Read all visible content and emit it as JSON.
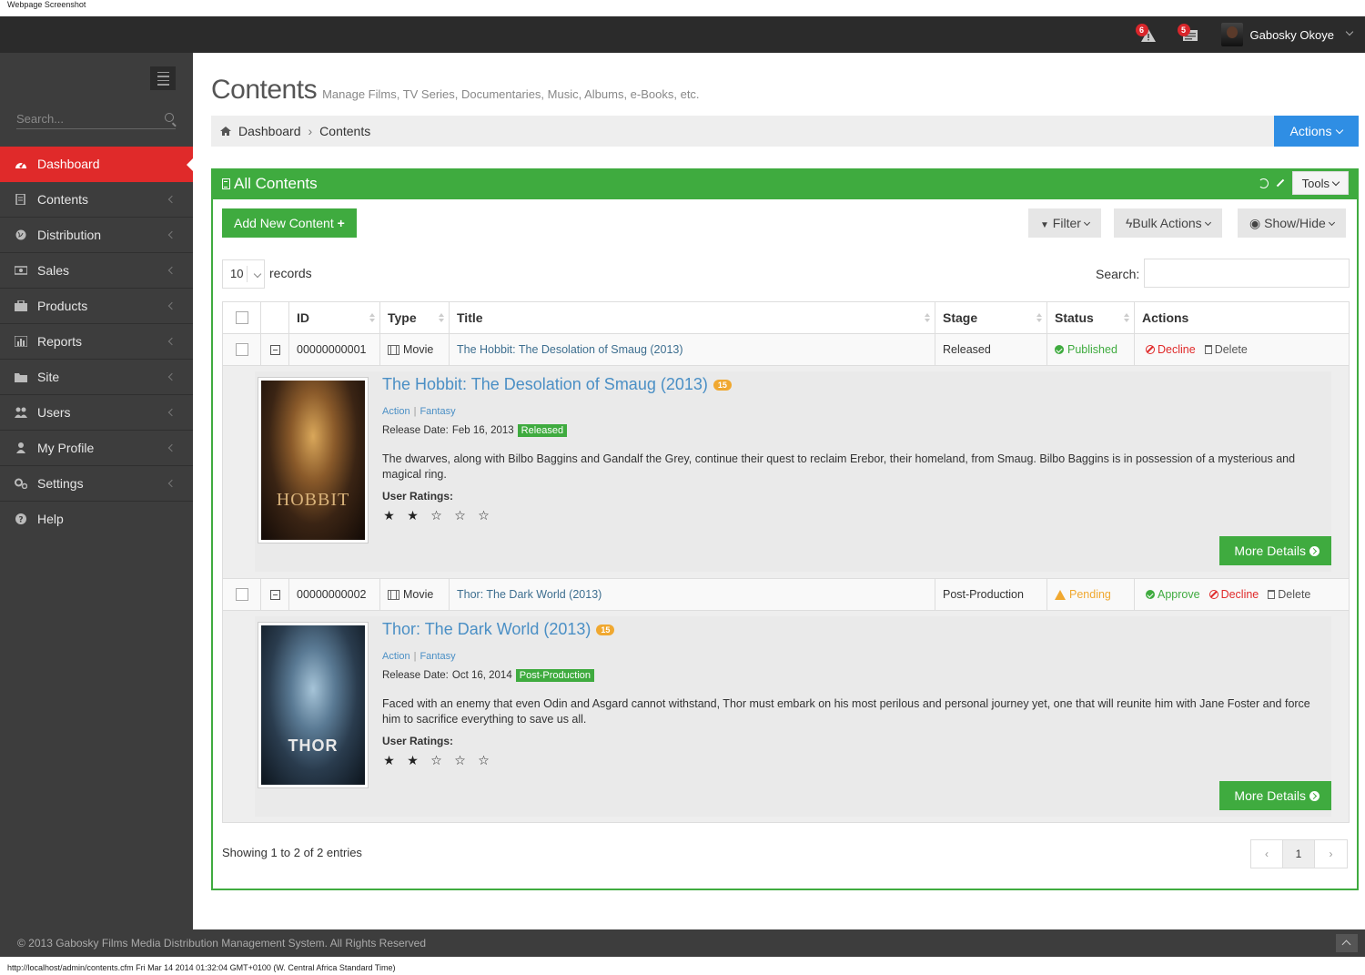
{
  "capture_label": "Webpage Screenshot",
  "topbar": {
    "notifications": [
      {
        "icon": "warning-icon",
        "count": "6"
      },
      {
        "icon": "messages-icon",
        "count": "5"
      }
    ],
    "user_name": "Gabosky Okoye"
  },
  "sidebar": {
    "search_placeholder": "Search...",
    "items": [
      {
        "label": "Dashboard",
        "icon": "dashboard-icon",
        "active": true
      },
      {
        "label": "Contents",
        "icon": "contents-icon"
      },
      {
        "label": "Distribution",
        "icon": "globe-icon"
      },
      {
        "label": "Sales",
        "icon": "money-icon"
      },
      {
        "label": "Products",
        "icon": "briefcase-icon"
      },
      {
        "label": "Reports",
        "icon": "bar-chart-icon"
      },
      {
        "label": "Site",
        "icon": "folder-icon"
      },
      {
        "label": "Users",
        "icon": "users-icon"
      },
      {
        "label": "My Profile",
        "icon": "user-icon"
      },
      {
        "label": "Settings",
        "icon": "cogs-icon"
      },
      {
        "label": "Help",
        "icon": "question-icon"
      }
    ]
  },
  "page": {
    "title": "Contents",
    "subtitle": "Manage Films, TV Series, Documentaries, Music, Albums, e-Books, etc.",
    "breadcrumb": [
      "Dashboard",
      "Contents"
    ],
    "actions_label": "Actions"
  },
  "panel": {
    "title": "All Contents",
    "tools_label": "Tools",
    "add_label": "Add New Content",
    "filter_label": "Filter",
    "bulk_label": "Bulk Actions",
    "showhide_label": "Show/Hide",
    "length_value": "10",
    "length_label": "records",
    "search_label": "Search:",
    "columns": [
      "ID",
      "Type",
      "Title",
      "Stage",
      "Status",
      "Actions"
    ],
    "rows": [
      {
        "id": "00000000001",
        "type": "Movie",
        "title": "The Hobbit: The Desolation of Smaug (2013)",
        "stage": "Released",
        "status": "Published",
        "actions": [
          "Decline",
          "Delete"
        ],
        "detail": {
          "title": "The Hobbit: The Desolation of Smaug (2013)",
          "age": "15",
          "genres": [
            "Action",
            "Fantasy"
          ],
          "release_label": "Release Date:",
          "release_date": "Feb 16, 2013",
          "stage_badge": "Released",
          "poster_text": "HOBBIT",
          "description": "The dwarves, along with Bilbo Baggins and Gandalf the Grey, continue their quest to reclaim Erebor, their homeland, from Smaug. Bilbo Baggins is in possession of a mysterious and magical ring.",
          "ratings_label": "User Ratings:",
          "rating": 2,
          "rating_max": 5,
          "more_label": "More Details"
        }
      },
      {
        "id": "00000000002",
        "type": "Movie",
        "title": "Thor: The Dark World (2013)",
        "stage": "Post-Production",
        "status": "Pending",
        "actions": [
          "Approve",
          "Decline",
          "Delete"
        ],
        "detail": {
          "title": "Thor: The Dark World (2013)",
          "age": "15",
          "genres": [
            "Action",
            "Fantasy"
          ],
          "release_label": "Release Date:",
          "release_date": "Oct 16, 2014",
          "stage_badge": "Post-Production",
          "poster_text": "THOR",
          "description": "Faced with an enemy that even Odin and Asgard cannot withstand, Thor must embark on his most perilous and personal journey yet, one that will reunite him with Jane Foster and force him to sacrifice everything to save us all.",
          "ratings_label": "User Ratings:",
          "rating": 2,
          "rating_max": 5,
          "more_label": "More Details"
        }
      }
    ],
    "info": "Showing 1 to 2 of 2 entries",
    "pager": {
      "prev": "‹",
      "current": "1",
      "next": "›"
    }
  },
  "footer": {
    "text": "© 2013 Gabosky Films Media Distribution Management System. All Rights Reserved"
  },
  "status_url": "http://localhost/admin/contents.cfm Fri Mar 14 2014 01:32:04 GMT+0100 (W. Central Africa Standard Time)",
  "colors": {
    "sidebar_bg": "#3d3d3d",
    "active_red": "#e02a2a",
    "panel_green": "#3fab3f",
    "actions_blue": "#2f8ee4",
    "pending_orange": "#f0a830"
  }
}
